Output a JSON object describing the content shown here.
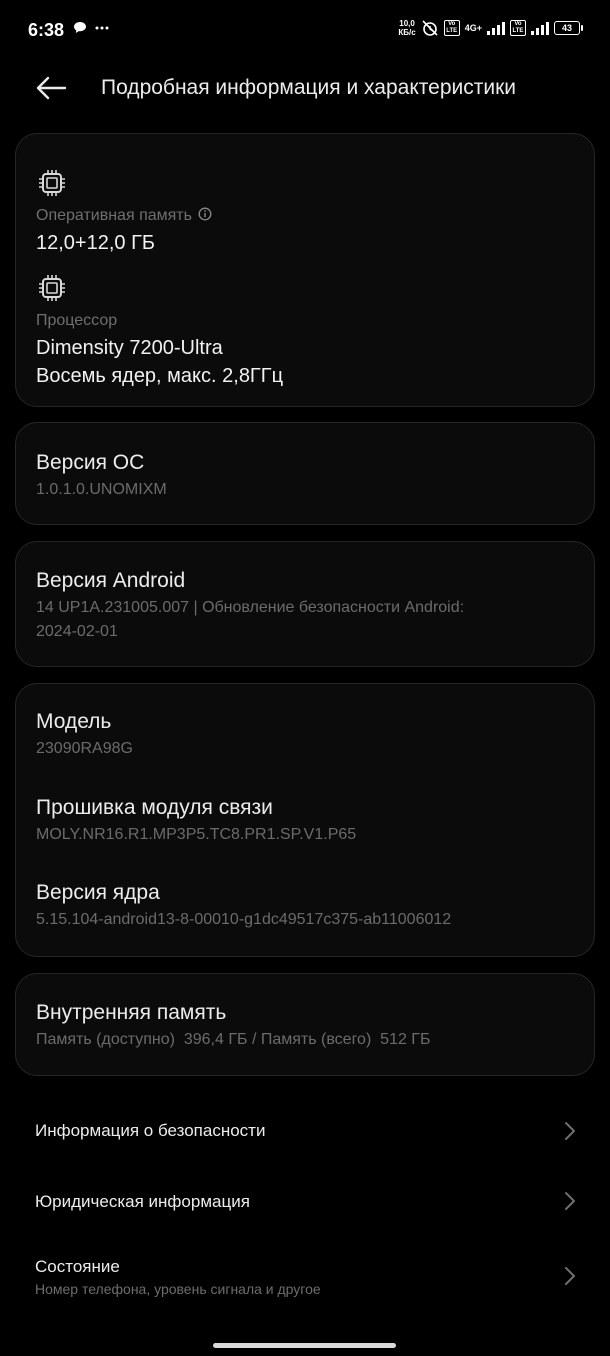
{
  "status_bar": {
    "time": "6:38",
    "net_speed_value": "10,0",
    "net_speed_unit": "КБ/с",
    "volte1": "Vo LTE",
    "network_type": "4G+",
    "volte2": "Vo LTE",
    "battery_level": "43",
    "icons": [
      "chat-bubble-icon",
      "more-dots-icon",
      "alarm-off-icon",
      "signal-icon",
      "battery-icon"
    ]
  },
  "header": {
    "title": "Подробная информация и характеристики",
    "back_icon": "arrow-left-icon"
  },
  "hardware": {
    "ram_label": "Оперативная память",
    "ram_value": "12,0+12,0 ГБ",
    "cpu_label": "Процессор",
    "cpu_name": "Dimensity 7200-Ultra",
    "cpu_detail": "Восемь ядер, макс. 2,8ГГц"
  },
  "os": {
    "title": "Версия ОС",
    "value": "1.0.1.0.UNOMIXM"
  },
  "android": {
    "title": "Версия Android",
    "line1": "14 UP1A.231005.007 | Обновление безопасности Android:",
    "line2": "2024-02-01"
  },
  "device": {
    "model_label": "Модель",
    "model_value": "23090RA98G",
    "baseband_label": "Прошивка модуля связи",
    "baseband_value": "MOLY.NR16.R1.MP3P5.TC8.PR1.SP.V1.P65",
    "kernel_label": "Версия ядра",
    "kernel_value": "5.15.104-android13-8-00010-g1dc49517c375-ab11006012"
  },
  "storage": {
    "title": "Внутренняя память",
    "detail": "Память (доступно)  396,4 ГБ / Память (всего)  512 ГБ"
  },
  "menu": {
    "security_info": "Информация о безопасности",
    "legal_info": "Юридическая информация",
    "status_title": "Состояние",
    "status_sub": "Номер телефона, уровень сигнала и другое"
  }
}
